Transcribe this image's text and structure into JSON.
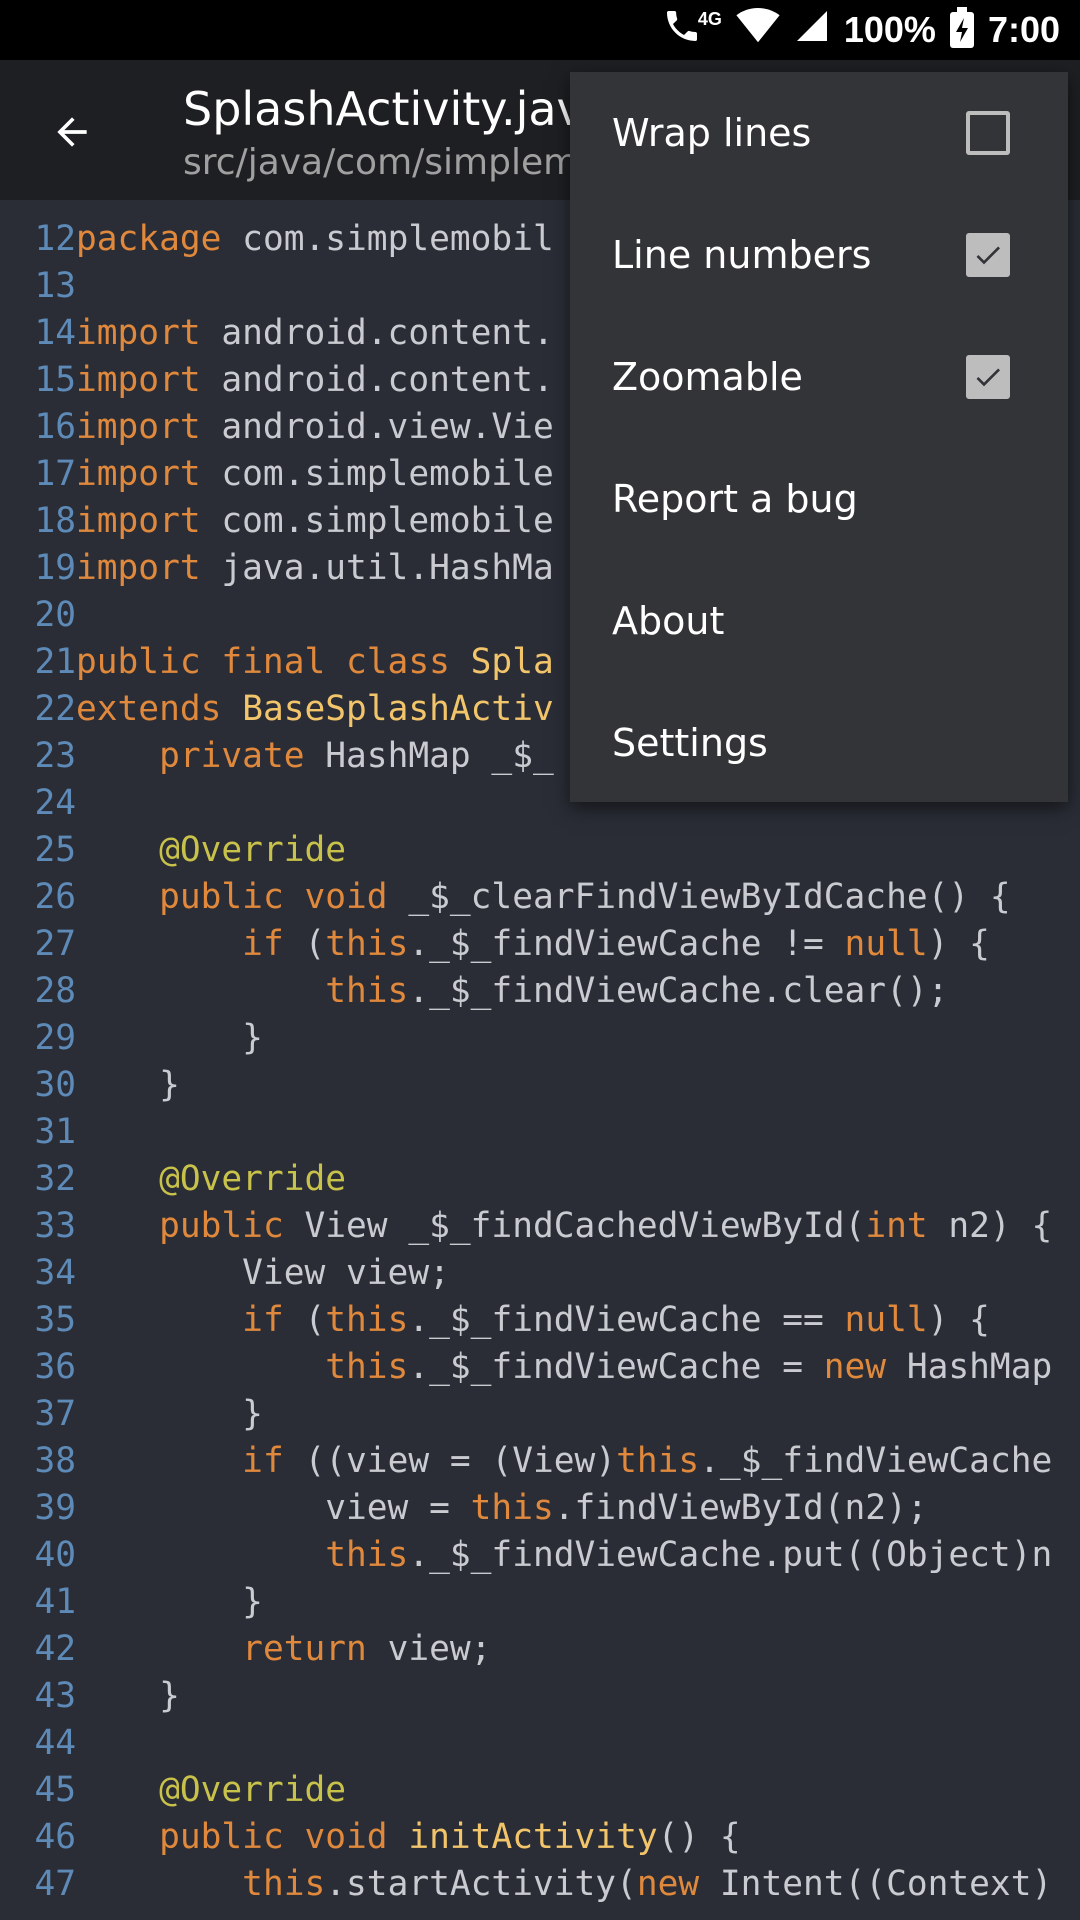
{
  "status_bar": {
    "network": "4G",
    "battery": "100%",
    "time": "7:00",
    "icons": [
      "call-icon",
      "wifi-icon",
      "signal-icon",
      "battery-charging-icon"
    ]
  },
  "app_bar": {
    "back_icon": "arrow-back-icon",
    "title": "SplashActivity.java",
    "subtitle": "src/java/com/simplemobiletools/"
  },
  "menu": {
    "items": [
      {
        "label": "Wrap lines",
        "checkbox": true,
        "checked": false
      },
      {
        "label": "Line numbers",
        "checkbox": true,
        "checked": true
      },
      {
        "label": "Zoomable",
        "checkbox": true,
        "checked": true
      },
      {
        "label": "Report a bug",
        "checkbox": false
      },
      {
        "label": "About",
        "checkbox": false
      },
      {
        "label": "Settings",
        "checkbox": false
      }
    ]
  },
  "colors": {
    "keyword": "#e0893c",
    "annotation": "#c8c24a",
    "class_name": "#f2c56b",
    "line_number": "#5e8ab8",
    "code_text": "#c9cbd1",
    "background": "#2a2d36"
  },
  "code": {
    "lines": [
      {
        "n": "12",
        "tokens": [
          [
            "kw",
            "package"
          ],
          [
            "t",
            " com.simplemobil"
          ]
        ]
      },
      {
        "n": "13",
        "tokens": []
      },
      {
        "n": "14",
        "tokens": [
          [
            "kw",
            "import"
          ],
          [
            "t",
            " android.content."
          ]
        ]
      },
      {
        "n": "15",
        "tokens": [
          [
            "kw",
            "import"
          ],
          [
            "t",
            " android.content."
          ]
        ]
      },
      {
        "n": "16",
        "tokens": [
          [
            "kw",
            "import"
          ],
          [
            "t",
            " android.view.Vie"
          ]
        ]
      },
      {
        "n": "17",
        "tokens": [
          [
            "kw",
            "import"
          ],
          [
            "t",
            " com.simplemobile"
          ]
        ]
      },
      {
        "n": "18",
        "tokens": [
          [
            "kw",
            "import"
          ],
          [
            "t",
            " com.simplemobile"
          ]
        ]
      },
      {
        "n": "19",
        "tokens": [
          [
            "kw",
            "import"
          ],
          [
            "t",
            " java.util.HashMa"
          ]
        ]
      },
      {
        "n": "20",
        "tokens": []
      },
      {
        "n": "21",
        "tokens": [
          [
            "kw",
            "public final class"
          ],
          [
            "t",
            " "
          ],
          [
            "cls",
            "Spla"
          ]
        ]
      },
      {
        "n": "22",
        "tokens": [
          [
            "kw",
            "extends"
          ],
          [
            "t",
            " "
          ],
          [
            "cls",
            "BaseSplashActiv"
          ]
        ]
      },
      {
        "n": "23",
        "tokens": [
          [
            "t",
            "    "
          ],
          [
            "kw",
            "private"
          ],
          [
            "t",
            " HashMap _$_"
          ]
        ]
      },
      {
        "n": "24",
        "tokens": []
      },
      {
        "n": "25",
        "tokens": [
          [
            "t",
            "    "
          ],
          [
            "ann",
            "@Override"
          ]
        ]
      },
      {
        "n": "26",
        "tokens": [
          [
            "t",
            "    "
          ],
          [
            "kw",
            "public void"
          ],
          [
            "t",
            " _$_clearFindViewByIdCache() {"
          ]
        ]
      },
      {
        "n": "27",
        "tokens": [
          [
            "t",
            "        "
          ],
          [
            "kw",
            "if"
          ],
          [
            "t",
            " ("
          ],
          [
            "kw",
            "this"
          ],
          [
            "t",
            "._$_findViewCache != "
          ],
          [
            "kw",
            "null"
          ],
          [
            "t",
            ") {"
          ]
        ]
      },
      {
        "n": "28",
        "tokens": [
          [
            "t",
            "            "
          ],
          [
            "kw",
            "this"
          ],
          [
            "t",
            "._$_findViewCache.clear();"
          ]
        ]
      },
      {
        "n": "29",
        "tokens": [
          [
            "t",
            "        }"
          ]
        ]
      },
      {
        "n": "30",
        "tokens": [
          [
            "t",
            "    }"
          ]
        ]
      },
      {
        "n": "31",
        "tokens": []
      },
      {
        "n": "32",
        "tokens": [
          [
            "t",
            "    "
          ],
          [
            "ann",
            "@Override"
          ]
        ]
      },
      {
        "n": "33",
        "tokens": [
          [
            "t",
            "    "
          ],
          [
            "kw",
            "public"
          ],
          [
            "t",
            " View _$_findCachedViewById("
          ],
          [
            "kw",
            "int"
          ],
          [
            "t",
            " n2) {"
          ]
        ]
      },
      {
        "n": "34",
        "tokens": [
          [
            "t",
            "        View view;"
          ]
        ]
      },
      {
        "n": "35",
        "tokens": [
          [
            "t",
            "        "
          ],
          [
            "kw",
            "if"
          ],
          [
            "t",
            " ("
          ],
          [
            "kw",
            "this"
          ],
          [
            "t",
            "._$_findViewCache == "
          ],
          [
            "kw",
            "null"
          ],
          [
            "t",
            ") {"
          ]
        ]
      },
      {
        "n": "36",
        "tokens": [
          [
            "t",
            "            "
          ],
          [
            "kw",
            "this"
          ],
          [
            "t",
            "._$_findViewCache = "
          ],
          [
            "kw",
            "new"
          ],
          [
            "t",
            " HashMap"
          ]
        ]
      },
      {
        "n": "37",
        "tokens": [
          [
            "t",
            "        }"
          ]
        ]
      },
      {
        "n": "38",
        "tokens": [
          [
            "t",
            "        "
          ],
          [
            "kw",
            "if"
          ],
          [
            "t",
            " ((view = (View)"
          ],
          [
            "kw",
            "this"
          ],
          [
            "t",
            "._$_findViewCache"
          ]
        ]
      },
      {
        "n": "39",
        "tokens": [
          [
            "t",
            "            view = "
          ],
          [
            "kw",
            "this"
          ],
          [
            "t",
            ".findViewById(n2);"
          ]
        ]
      },
      {
        "n": "40",
        "tokens": [
          [
            "t",
            "            "
          ],
          [
            "kw",
            "this"
          ],
          [
            "t",
            "._$_findViewCache.put((Object)n"
          ]
        ]
      },
      {
        "n": "41",
        "tokens": [
          [
            "t",
            "        }"
          ]
        ]
      },
      {
        "n": "42",
        "tokens": [
          [
            "t",
            "        "
          ],
          [
            "kw",
            "return"
          ],
          [
            "t",
            " view;"
          ]
        ]
      },
      {
        "n": "43",
        "tokens": [
          [
            "t",
            "    }"
          ]
        ]
      },
      {
        "n": "44",
        "tokens": []
      },
      {
        "n": "45",
        "tokens": [
          [
            "t",
            "    "
          ],
          [
            "ann",
            "@Override"
          ]
        ]
      },
      {
        "n": "46",
        "tokens": [
          [
            "t",
            "    "
          ],
          [
            "kw",
            "public void"
          ],
          [
            "t",
            " "
          ],
          [
            "fn",
            "initActivity"
          ],
          [
            "t",
            "() {"
          ]
        ]
      },
      {
        "n": "47",
        "tokens": [
          [
            "t",
            "        "
          ],
          [
            "kw",
            "this"
          ],
          [
            "t",
            ".startActivity("
          ],
          [
            "kw",
            "new"
          ],
          [
            "t",
            " Intent((Context)"
          ]
        ]
      }
    ]
  }
}
